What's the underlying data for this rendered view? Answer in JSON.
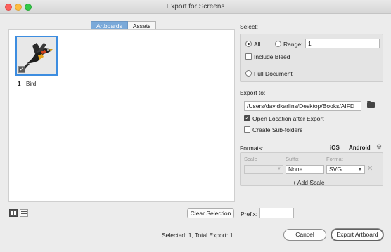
{
  "window": {
    "title": "Export for Screens"
  },
  "tabs": [
    {
      "label": "Artboards",
      "active": true
    },
    {
      "label": "Assets",
      "active": false
    }
  ],
  "artboards": [
    {
      "number": "1",
      "name": "Bird",
      "selected": true
    }
  ],
  "footer": {
    "clear_selection": "Clear Selection",
    "prefix_label": "Prefix:",
    "prefix_value": "",
    "summary": "Selected: 1, Total Export: 1",
    "cancel": "Cancel",
    "export": "Export Artboard"
  },
  "select": {
    "label": "Select:",
    "all_label": "All",
    "range_label": "Range:",
    "range_value": "1",
    "include_bleed": "Include Bleed",
    "full_document": "Full Document",
    "selected_option": "all"
  },
  "export_to": {
    "label": "Export to:",
    "path": "/Users/davidkarlins/Desktop/Books/AIFD",
    "open_location": "Open Location after Export",
    "open_location_checked": true,
    "create_subfolders": "Create Sub-folders",
    "create_subfolders_checked": false
  },
  "formats": {
    "label": "Formats:",
    "ios": "iOS",
    "android": "Android",
    "col_scale": "Scale",
    "col_suffix": "Suffix",
    "col_format": "Format",
    "suffix_value": "None",
    "format_value": "SVG",
    "add_scale": "+ Add Scale"
  },
  "colors": {
    "accent": "#7aa9d9",
    "thumb_border": "#3d8de0"
  }
}
